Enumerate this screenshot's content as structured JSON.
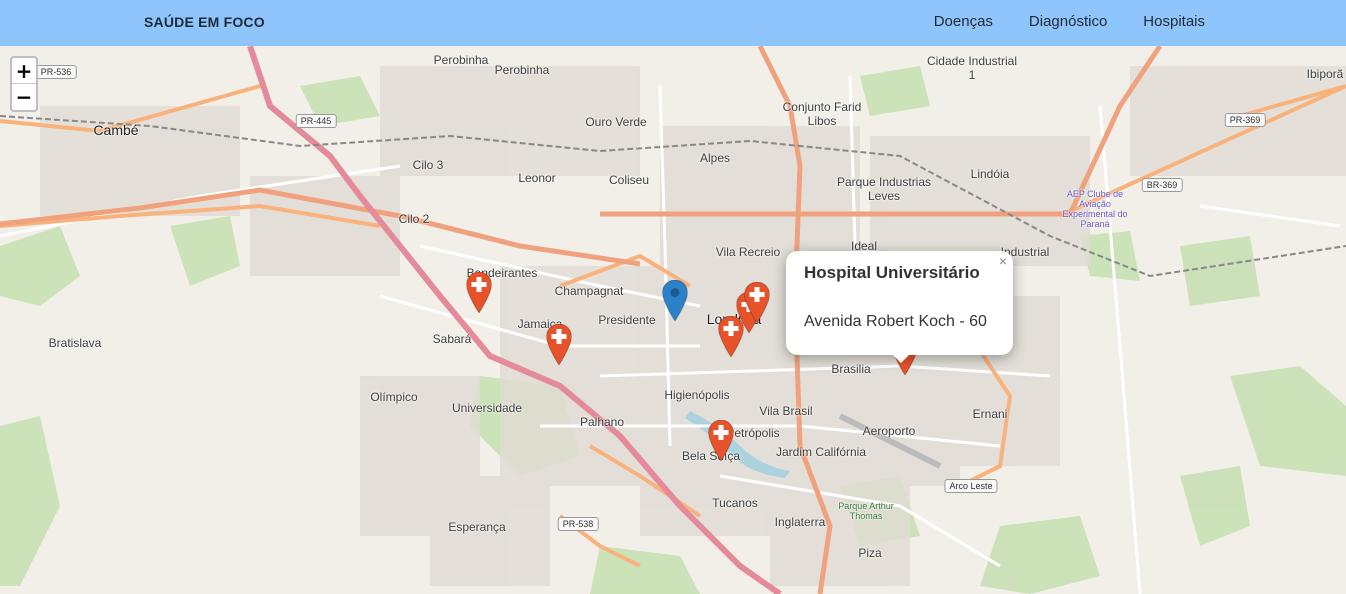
{
  "navbar": {
    "brand": "SAÚDE EM FOCO",
    "links": [
      "Doenças",
      "Diagnóstico",
      "Hospitais"
    ],
    "background": "#8ec5fc"
  },
  "zoom": {
    "in_label": "+",
    "out_label": "−"
  },
  "popup": {
    "title": "Hospital Universitário",
    "address": "Avenida Robert Koch - 60",
    "close_label": "×"
  },
  "map_labels": {
    "perobinha": "Perobinha",
    "perobinha2": "Perobinha",
    "cidade_industrial": "Cidade Industrial",
    "cidade_industrial_num": "1",
    "ibipora": "Ibiporã",
    "cambe": "Cambé",
    "ouro_verde": "Ouro Verde",
    "conjunto_farid": "Conjunto Farid",
    "libos": "Libos",
    "alpes": "Alpes",
    "cilo3": "Cilo 3",
    "leonor": "Leonor",
    "coliseu": "Coliseu",
    "parque_industrias": "Parque Industrias",
    "leves": "Leves",
    "lindoia": "Lindóia",
    "cilo2": "Cilo 2",
    "vila_recreio": "Vila Recreio",
    "ideal": "Ideal",
    "industrial": "Industrial",
    "bandeirantes": "Bandeirantes",
    "champagnat": "Champagnat",
    "jamaica": "Jamaica",
    "presidente": "Presidente",
    "londrina": "Londrina",
    "sabara": "Sabará",
    "bratislava": "Bratislava",
    "brasilia": "Brasilia",
    "olimpico": "Olímpico",
    "universidade": "Universidade",
    "higienopolis": "Higienópolis",
    "palhano": "Palhano",
    "vila_brasil": "Vila Brasil",
    "ernani": "Ernani",
    "aeroporto": "Aeroporto",
    "petropolis": "Petrópolis",
    "jardim_california": "Jardim Califórnia",
    "bela_suica": "Bela Suíça",
    "tucanos": "Tucanos",
    "esperanca": "Esperança",
    "inglaterra": "Inglaterra",
    "pizza": "Piza",
    "parque_arthur": "Parque Arthur Thomas",
    "aeroclube": "AEP Clube de Aviação Experimental do Paraná"
  },
  "road_shields": {
    "pr536": "PR-536",
    "pr445": "PR-445",
    "pr369": "PR-369",
    "br369": "BR-369",
    "pr538": "PR-538",
    "arco_leste": "Arco Leste"
  },
  "markers": {
    "hospital_color": "#e8522b",
    "user_color": "#2b82cb",
    "hospital_icon": "cross-icon"
  }
}
